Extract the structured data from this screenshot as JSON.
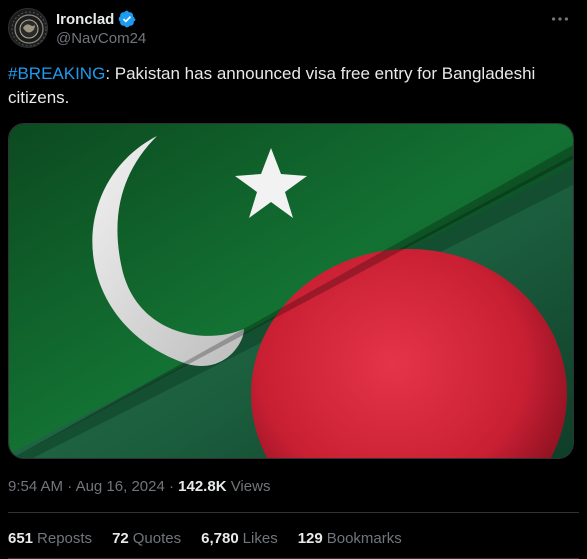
{
  "author": {
    "display_name": "Ironclad",
    "handle": "@NavCom24",
    "verified_color": "#1d9bf0",
    "avatar_icon": "globe-emblem-icon"
  },
  "tweet": {
    "hashtag": "#BREAKING",
    "text": ": Pakistan has announced visa free entry for Bangladeshi citizens."
  },
  "media": {
    "description_icon": "pakistan-bangladesh-flags-image",
    "colors": {
      "pakistan_green": "#0f5a28",
      "bangladesh_green": "#1d6b46",
      "bangladesh_red": "#d8283c"
    }
  },
  "meta": {
    "time": "9:54 AM",
    "separator": "·",
    "date": "Aug 16, 2024",
    "views_count": "142.8K",
    "views_label": "Views"
  },
  "stats": {
    "reposts": {
      "count": "651",
      "label": "Reposts"
    },
    "quotes": {
      "count": "72",
      "label": "Quotes"
    },
    "likes": {
      "count": "6,780",
      "label": "Likes"
    },
    "bookmarks": {
      "count": "129",
      "label": "Bookmarks"
    }
  }
}
